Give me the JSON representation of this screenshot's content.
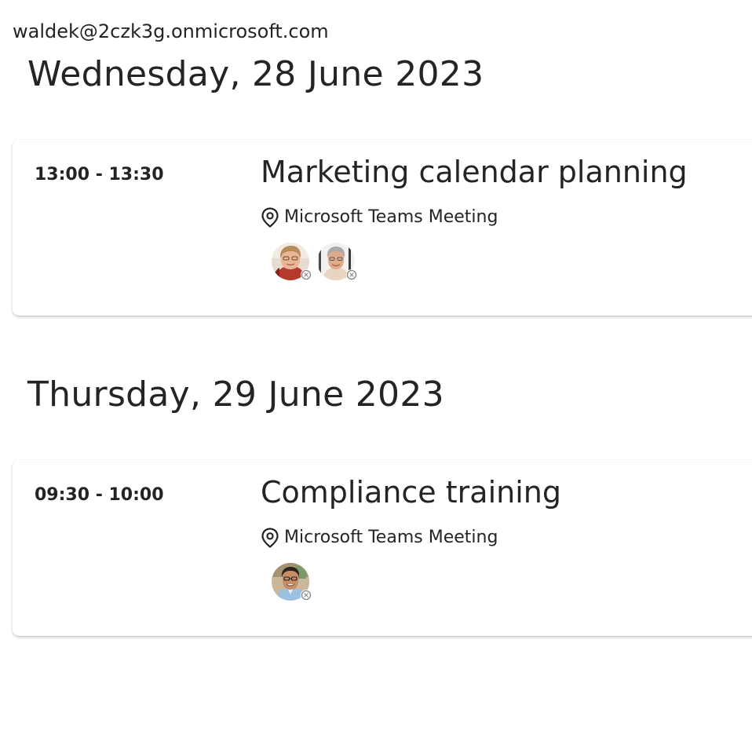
{
  "user": {
    "email": "waldek@2czk3g.onmicrosoft.com"
  },
  "days": [
    {
      "heading": "Wednesday, 28 June 2023",
      "events": [
        {
          "time": "13:00 - 13:30",
          "title": "Marketing calendar planning",
          "location": "Microsoft Teams Meeting",
          "attendees": [
            {
              "avatar": "woman-with-glasses-avatar",
              "presence": "offline"
            },
            {
              "avatar": "man-grey-hair-avatar",
              "presence": "offline"
            }
          ]
        }
      ]
    },
    {
      "heading": "Thursday, 29 June 2023",
      "events": [
        {
          "time": "09:30 - 10:00",
          "title": "Compliance training",
          "location": "Microsoft Teams Meeting",
          "attendees": [
            {
              "avatar": "man-glasses-avatar",
              "presence": "offline"
            }
          ]
        }
      ]
    }
  ],
  "colors": {
    "text": "#242424",
    "card_background": "#ffffff",
    "presence_offline": "#8a8886"
  },
  "icons": {
    "location": "location-pin-icon",
    "presence": "presence-offline-icon"
  }
}
